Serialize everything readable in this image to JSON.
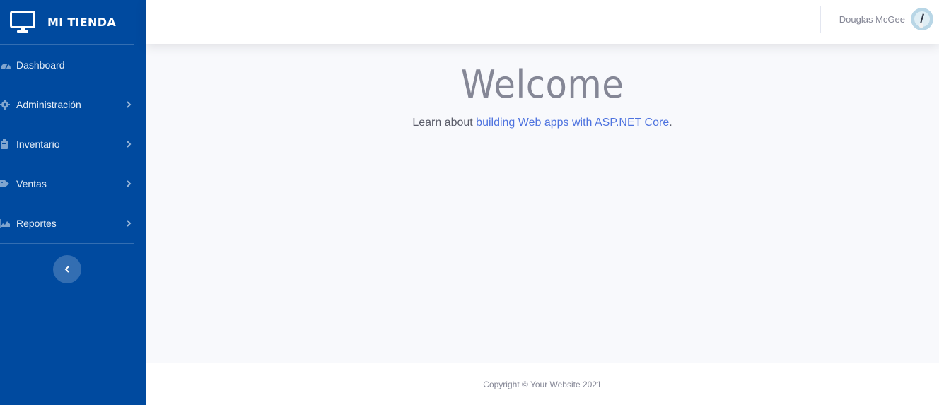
{
  "brand": {
    "name": "MI TIENDA",
    "icon": "monitor-icon"
  },
  "sidebar": {
    "items": [
      {
        "label": "Dashboard",
        "icon": "tachometer-icon",
        "has_submenu": false
      },
      {
        "label": "Administración",
        "icon": "gear-icon",
        "has_submenu": true
      },
      {
        "label": "Inventario",
        "icon": "clipboard-icon",
        "has_submenu": true
      },
      {
        "label": "Ventas",
        "icon": "tags-icon",
        "has_submenu": true
      },
      {
        "label": "Reportes",
        "icon": "chart-area-icon",
        "has_submenu": true
      }
    ],
    "toggle_icon": "chevron-left-icon"
  },
  "topbar": {
    "user_name": "Douglas McGee"
  },
  "main": {
    "heading": "Welcome",
    "intro": "Learn about ",
    "link_text": "building Web apps with ASP.NET Core",
    "trailing": "."
  },
  "footer": {
    "copyright": "Copyright © Your Website 2021"
  },
  "colors": {
    "sidebar_bg": "#004a9f",
    "page_bg": "#f8f9fc",
    "link": "#4e73df",
    "muted": "#858796"
  }
}
